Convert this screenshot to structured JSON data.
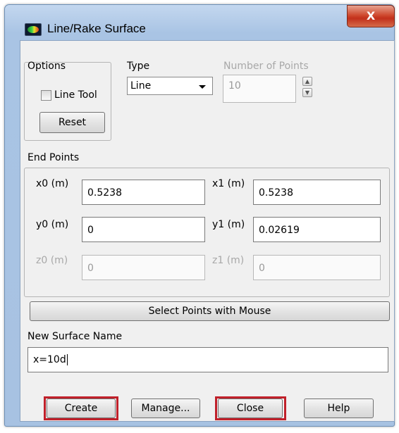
{
  "window": {
    "title": "Line/Rake Surface",
    "close_glyph": "X"
  },
  "options": {
    "heading": "Options",
    "line_tool_label": "Line Tool",
    "line_tool_checked": false,
    "reset_label": "Reset"
  },
  "type": {
    "heading": "Type",
    "selected": "Line"
  },
  "points": {
    "heading": "Number of Points",
    "value": "10"
  },
  "end_points": {
    "heading": "End Points",
    "x0_label": "x0 (m)",
    "x0_value": "0.5238",
    "x1_label": "x1 (m)",
    "x1_value": "0.5238",
    "y0_label": "y0 (m)",
    "y0_value": "0",
    "y1_label": "y1 (m)",
    "y1_value": "0.02619",
    "z0_label": "z0 (m)",
    "z0_value": "0",
    "z1_label": "z1 (m)",
    "z1_value": "0"
  },
  "select_points_label": "Select Points with Mouse",
  "new_surface": {
    "heading": "New Surface Name",
    "value": "x=10d"
  },
  "buttons": {
    "create": "Create",
    "manage": "Manage...",
    "close": "Close",
    "help": "Help"
  },
  "colors": {
    "highlight": "#c0202a",
    "title_bar": "#a9c4e4",
    "close_button": "#c2301b"
  }
}
